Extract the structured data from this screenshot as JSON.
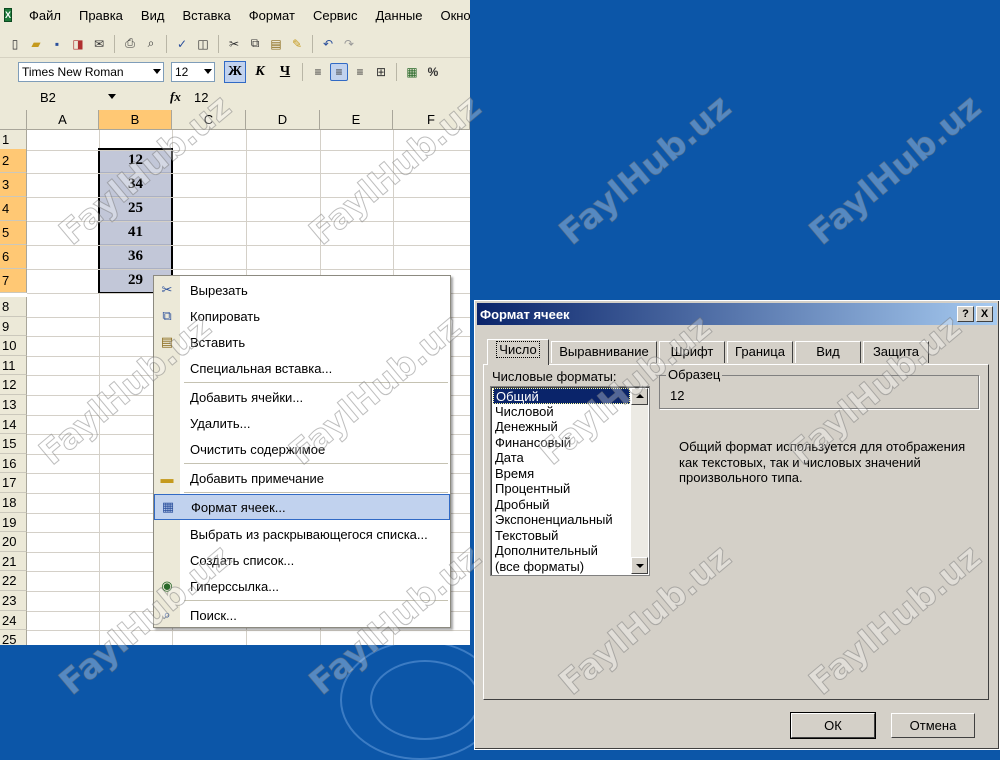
{
  "excel": {
    "menu": [
      "Файл",
      "Правка",
      "Вид",
      "Вставка",
      "Формат",
      "Сервис",
      "Данные",
      "Окно"
    ],
    "font_name": "Times New Roman",
    "font_size": "12",
    "bold_label": "Ж",
    "italic_label": "К",
    "underline_label": "Ч",
    "percent_label": "%",
    "name_box": "B2",
    "fx_label": "fx",
    "formula_value": "12",
    "columns": [
      "A",
      "B",
      "C",
      "D",
      "E",
      "F"
    ],
    "rows": [
      "1",
      "2",
      "3",
      "4",
      "5",
      "6",
      "7",
      "8",
      "9",
      "10",
      "11",
      "12",
      "13",
      "14",
      "15",
      "16",
      "17",
      "18",
      "19",
      "20",
      "21",
      "22",
      "23",
      "24",
      "25"
    ],
    "cells_b": [
      "12",
      "34",
      "25",
      "41",
      "36",
      "29"
    ]
  },
  "context_menu": {
    "items": [
      "Вырезать",
      "Копировать",
      "Вставить",
      "Специальная вставка...",
      "Добавить ячейки...",
      "Удалить...",
      "Очистить содержимое",
      "Добавить примечание",
      "Формат ячеек...",
      "Выбрать из раскрывающегося списка...",
      "Создать список...",
      "Гиперссылка...",
      "Поиск..."
    ]
  },
  "dialog": {
    "title": "Формат ячеек",
    "help_btn": "?",
    "close_btn": "X",
    "tabs": [
      "Число",
      "Выравнивание",
      "Шрифт",
      "Граница",
      "Вид",
      "Защита"
    ],
    "formats_label": "Числовые форматы:",
    "formats": [
      "Общий",
      "Числовой",
      "Денежный",
      "Финансовый",
      "Дата",
      "Время",
      "Процентный",
      "Дробный",
      "Экспоненциальный",
      "Текстовый",
      "Дополнительный",
      "(все форматы)"
    ],
    "sample_label": "Образец",
    "sample_value": "12",
    "description": "Общий формат используется для отображения как текстовых, так и числовых значений произвольного типа.",
    "ok": "ОК",
    "cancel": "Отмена"
  },
  "watermark": "FaylHub.uz"
}
